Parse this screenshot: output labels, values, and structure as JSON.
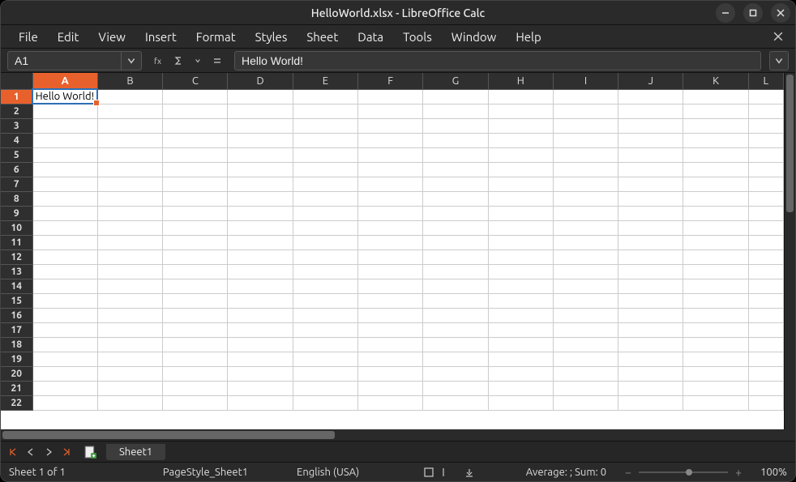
{
  "window": {
    "title": "HelloWorld.xlsx - LibreOffice Calc"
  },
  "menu": {
    "file": "File",
    "edit": "Edit",
    "view": "View",
    "insert": "Insert",
    "format": "Format",
    "styles": "Styles",
    "sheet": "Sheet",
    "data": "Data",
    "tools": "Tools",
    "window": "Window",
    "help": "Help"
  },
  "formula": {
    "namebox": "A1",
    "input": "Hello World!"
  },
  "columns": [
    "A",
    "B",
    "C",
    "D",
    "E",
    "F",
    "G",
    "H",
    "I",
    "J",
    "K",
    "L"
  ],
  "rows_visible": 22,
  "selection": {
    "col": "A",
    "row": 1
  },
  "cells": {
    "A1": "Hello World!"
  },
  "tabs": {
    "sheet1": "Sheet1"
  },
  "status": {
    "sheet_pos": "Sheet 1 of 1",
    "page_style": "PageStyle_Sheet1",
    "language": "English (USA)",
    "aggregate": "Average: ; Sum: 0",
    "zoom": "100%"
  },
  "colors": {
    "accent": "#e8612c"
  }
}
